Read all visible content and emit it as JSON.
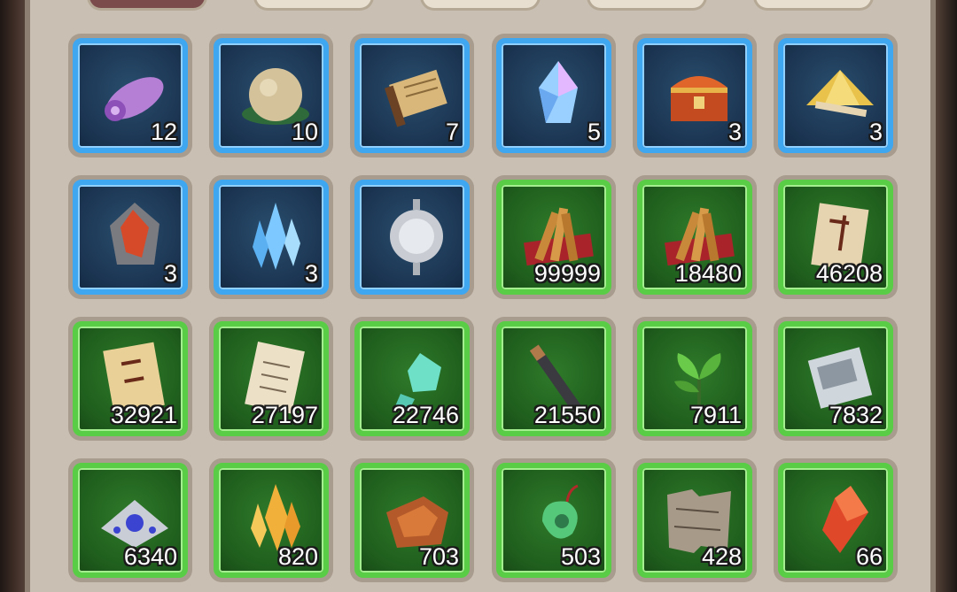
{
  "colors": {
    "panel_bg": "#c9bfb2",
    "blue_rarity": "#3fa6f0",
    "green_rarity": "#5acd47",
    "active_tab": "#7b4a4a"
  },
  "tabs": [
    {
      "label": "",
      "active": true
    },
    {
      "label": "",
      "active": false
    },
    {
      "label": "",
      "active": false
    },
    {
      "label": "",
      "active": false
    },
    {
      "label": "",
      "active": false
    }
  ],
  "items": [
    {
      "icon": "purple-cloth-roll-icon",
      "count": "12",
      "rarity": "blue"
    },
    {
      "icon": "dough-ball-icon",
      "count": "10",
      "rarity": "blue"
    },
    {
      "icon": "scroll-icon",
      "count": "7",
      "rarity": "blue"
    },
    {
      "icon": "crystal-gem-icon",
      "count": "5",
      "rarity": "blue"
    },
    {
      "icon": "treasure-chest-icon",
      "count": "3",
      "rarity": "blue"
    },
    {
      "icon": "gold-powder-icon",
      "count": "3",
      "rarity": "blue"
    },
    {
      "icon": "red-ore-icon",
      "count": "3",
      "rarity": "blue"
    },
    {
      "icon": "blue-crystal-cluster-icon",
      "count": "3",
      "rarity": "blue"
    },
    {
      "icon": "silver-orb-icon",
      "count": "",
      "rarity": "blue"
    },
    {
      "icon": "wood-bundle-icon",
      "count": "99999",
      "rarity": "green"
    },
    {
      "icon": "wood-bundle-icon",
      "count": "18480",
      "rarity": "green"
    },
    {
      "icon": "letter-icon",
      "count": "46208",
      "rarity": "green"
    },
    {
      "icon": "talisman-paper-icon",
      "count": "32921",
      "rarity": "green"
    },
    {
      "icon": "manual-page-icon",
      "count": "27197",
      "rarity": "green"
    },
    {
      "icon": "jade-fragment-icon",
      "count": "22746",
      "rarity": "green"
    },
    {
      "icon": "ink-stick-icon",
      "count": "21550",
      "rarity": "green"
    },
    {
      "icon": "herb-leaf-icon",
      "count": "7911",
      "rarity": "green"
    },
    {
      "icon": "silver-book-icon",
      "count": "7832",
      "rarity": "green"
    },
    {
      "icon": "silver-ornament-icon",
      "count": "6340",
      "rarity": "green"
    },
    {
      "icon": "amber-crystal-icon",
      "count": "820",
      "rarity": "green"
    },
    {
      "icon": "copper-ore-icon",
      "count": "703",
      "rarity": "green"
    },
    {
      "icon": "jade-pendant-icon",
      "count": "503",
      "rarity": "green"
    },
    {
      "icon": "torn-map-icon",
      "count": "428",
      "rarity": "green"
    },
    {
      "icon": "red-gem-icon",
      "count": "66",
      "rarity": "green"
    }
  ]
}
